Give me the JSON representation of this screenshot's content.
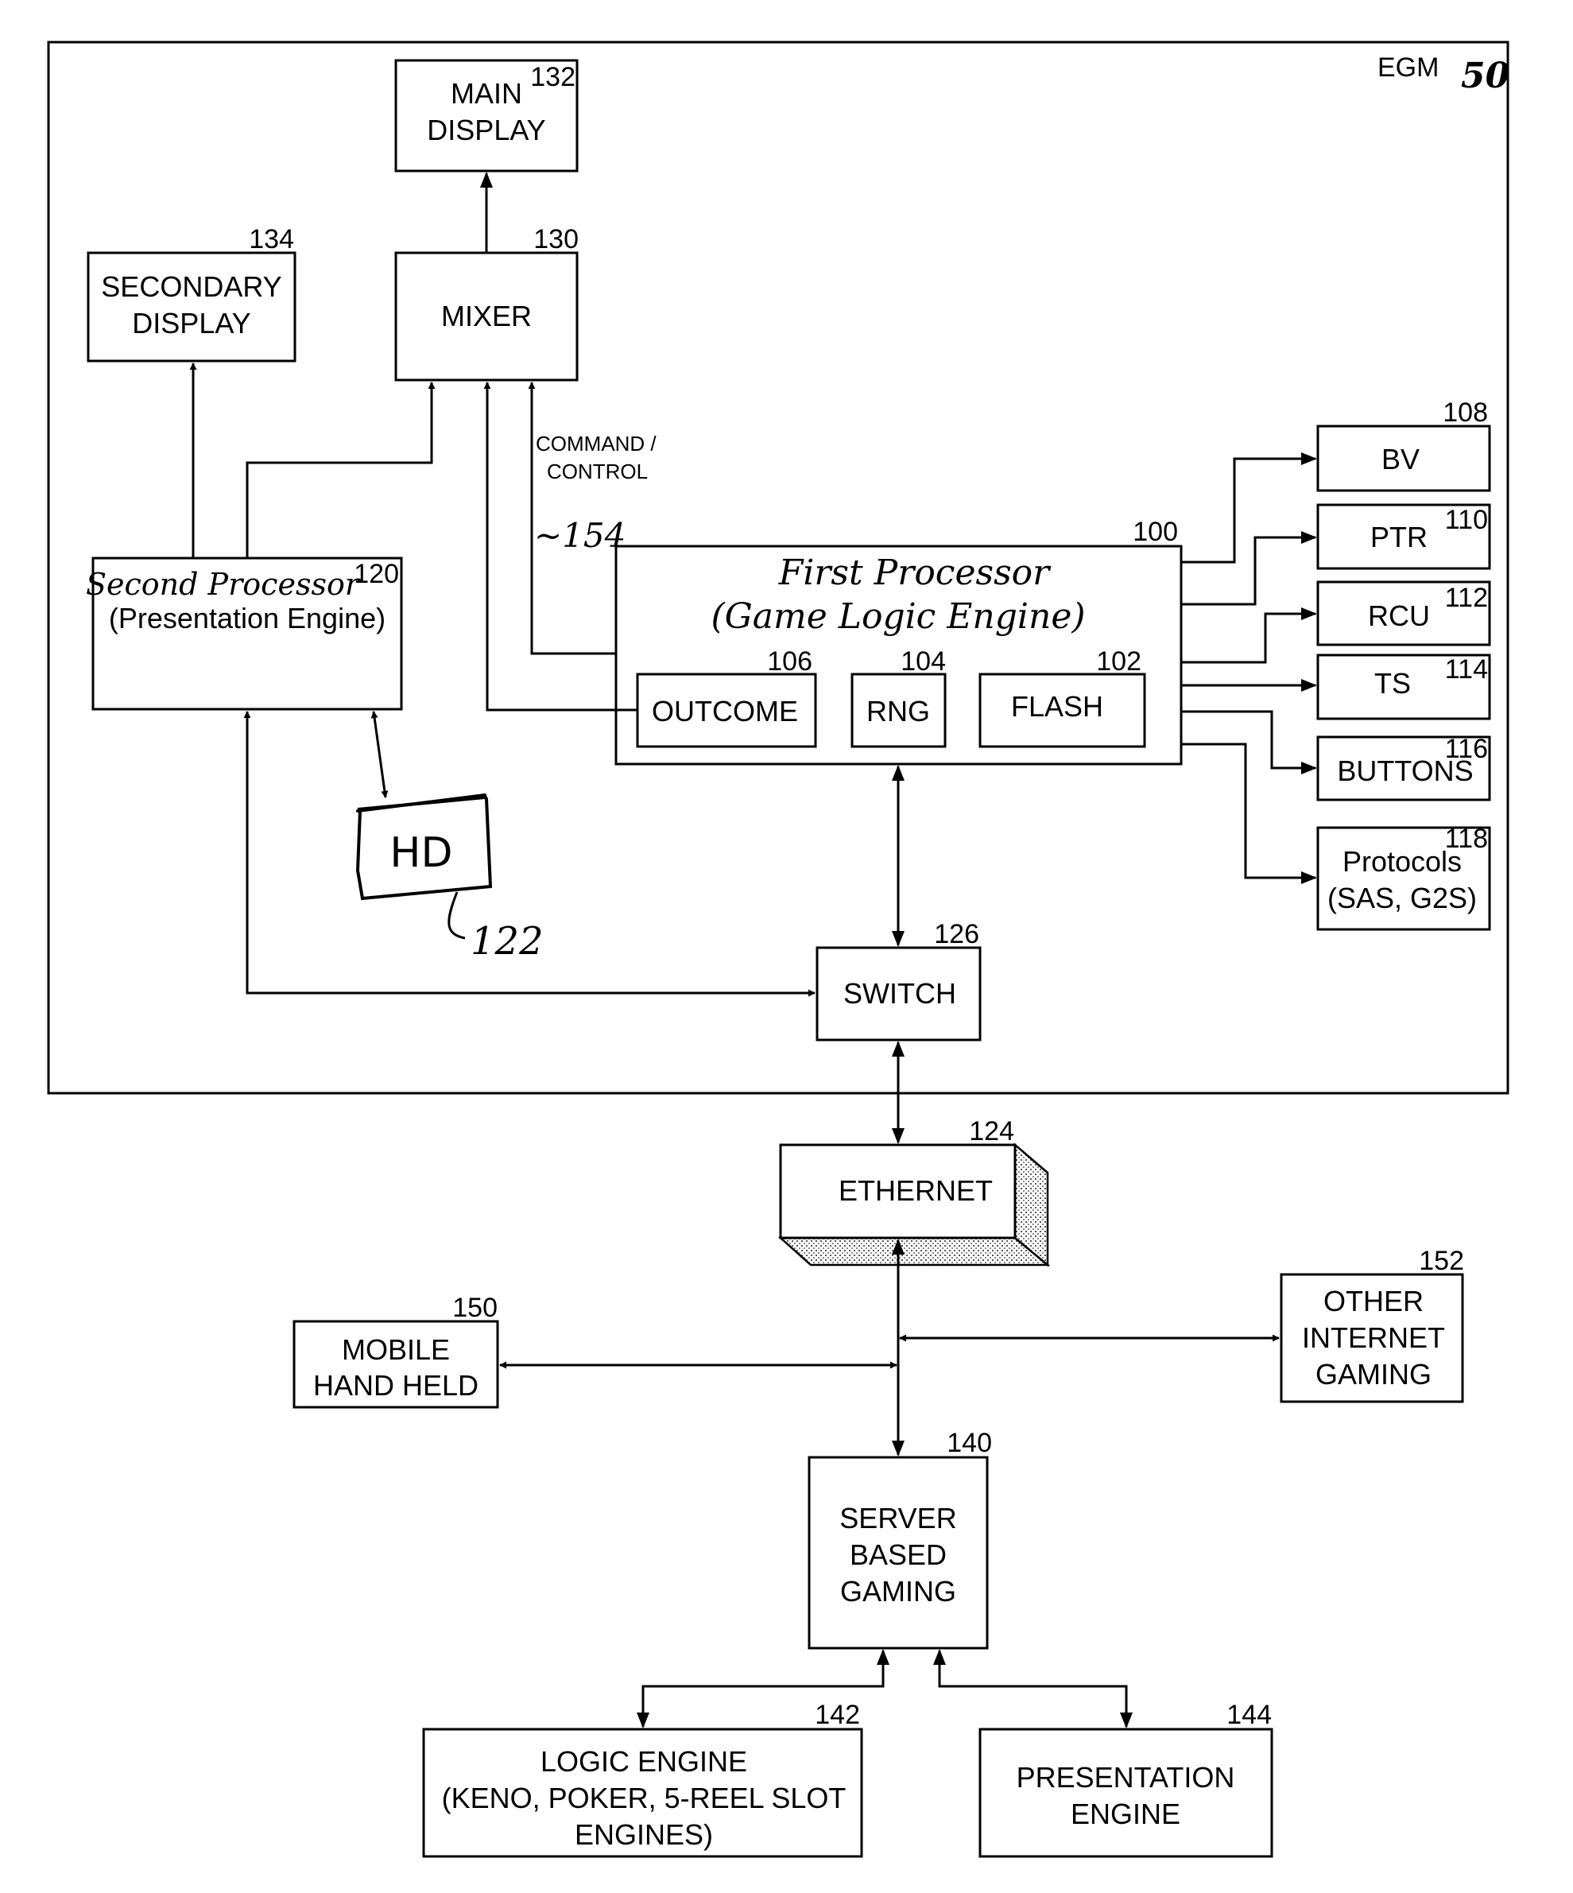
{
  "diagram": {
    "frame_label": "EGM",
    "frame_ref": "50",
    "nodes": {
      "main_display": {
        "ref": "132",
        "lines": [
          "MAIN",
          "DISPLAY"
        ]
      },
      "mixer": {
        "ref": "130",
        "lines": [
          "MIXER"
        ]
      },
      "secondary_display": {
        "ref": "134",
        "lines": [
          "SECONDARY",
          "DISPLAY"
        ]
      },
      "second_processor": {
        "ref": "120",
        "lines": [
          "Second Processor",
          "(Presentation Engine)"
        ]
      },
      "hard_drive": {
        "ref": "122",
        "lines": [
          "HD"
        ]
      },
      "first_processor": {
        "ref": "100",
        "lines": [
          "First Processor",
          "(Game Logic Engine)"
        ]
      },
      "outcome": {
        "ref": "106",
        "lines": [
          "OUTCOME"
        ]
      },
      "rng": {
        "ref": "104",
        "lines": [
          "RNG"
        ]
      },
      "flash": {
        "ref": "102",
        "lines": [
          "FLASH"
        ]
      },
      "bv": {
        "ref": "108",
        "lines": [
          "BV"
        ]
      },
      "ptr": {
        "ref": "110",
        "lines": [
          "PTR"
        ]
      },
      "rcu": {
        "ref": "112",
        "lines": [
          "RCU"
        ]
      },
      "ts": {
        "ref": "114",
        "lines": [
          "TS"
        ]
      },
      "buttons": {
        "ref": "116",
        "lines": [
          "BUTTONS"
        ]
      },
      "protocols": {
        "ref": "118",
        "lines": [
          "Protocols",
          "(SAS, G2S)"
        ]
      },
      "switch": {
        "ref": "126",
        "lines": [
          "SWITCH"
        ]
      },
      "ethernet": {
        "ref": "124",
        "lines": [
          "ETHERNET"
        ]
      },
      "mobile": {
        "ref": "150",
        "lines": [
          "MOBILE",
          "HAND HELD"
        ]
      },
      "other_internet": {
        "ref": "152",
        "lines": [
          "OTHER",
          "INTERNET",
          "GAMING"
        ]
      },
      "server": {
        "ref": "140",
        "lines": [
          "SERVER",
          "BASED",
          "GAMING"
        ]
      },
      "logic_engine": {
        "ref": "142",
        "lines": [
          "LOGIC ENGINE",
          "(KENO, POKER, 5-REEL SLOT",
          "ENGINES)"
        ]
      },
      "presentation_engine": {
        "ref": "144",
        "lines": [
          "PRESENTATION",
          "ENGINE"
        ]
      }
    },
    "command_control": {
      "lines": [
        "COMMAND /",
        "CONTROL"
      ],
      "ref": "~154"
    }
  }
}
